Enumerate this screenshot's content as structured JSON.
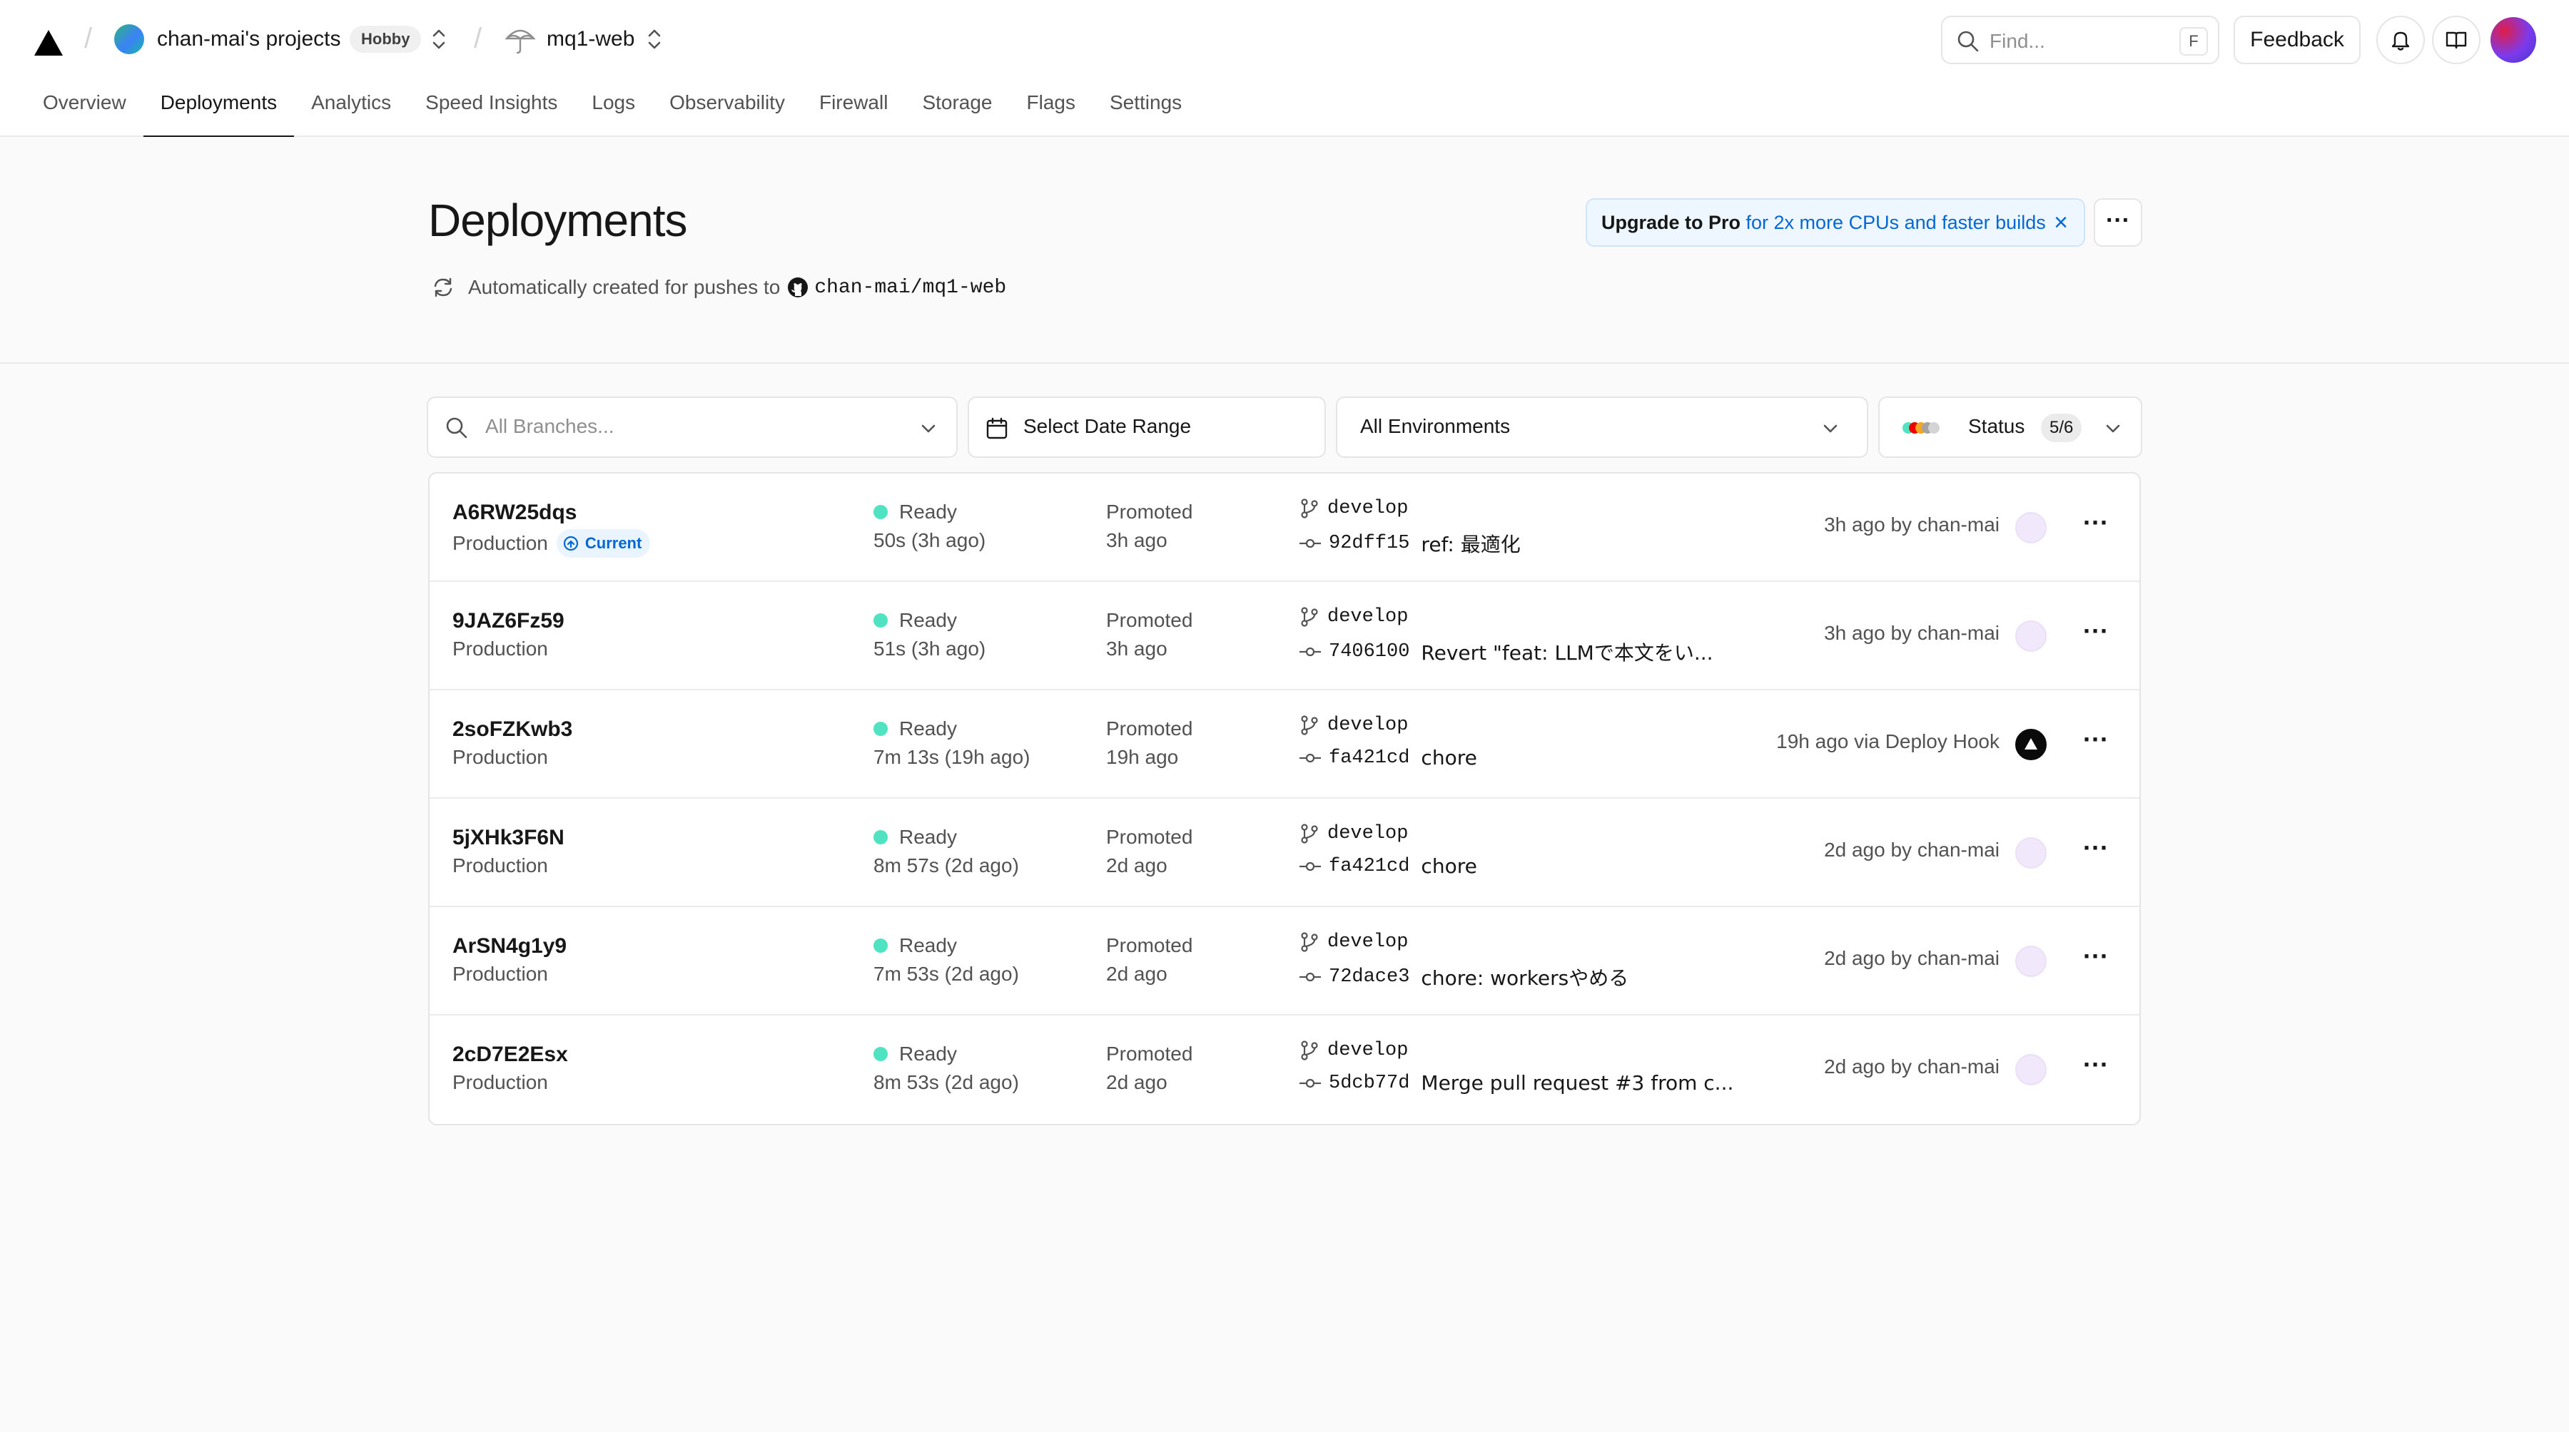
{
  "header": {
    "team_name": "chan-mai's projects",
    "plan_badge": "Hobby",
    "project_name": "mq1-web",
    "search": {
      "placeholder": "Find...",
      "shortcut": "F"
    },
    "feedback_label": "Feedback"
  },
  "tabs": [
    {
      "label": "Overview",
      "active": false
    },
    {
      "label": "Deployments",
      "active": true
    },
    {
      "label": "Analytics",
      "active": false
    },
    {
      "label": "Speed Insights",
      "active": false
    },
    {
      "label": "Logs",
      "active": false
    },
    {
      "label": "Observability",
      "active": false
    },
    {
      "label": "Firewall",
      "active": false
    },
    {
      "label": "Storage",
      "active": false
    },
    {
      "label": "Flags",
      "active": false
    },
    {
      "label": "Settings",
      "active": false
    }
  ],
  "page": {
    "title": "Deployments",
    "subtitle_prefix": "Automatically created for pushes to",
    "repo": "chan-mai/mq1-web",
    "upgrade_strong": "Upgrade to Pro",
    "upgrade_rest": "for 2x more CPUs and faster builds"
  },
  "filters": {
    "branches_placeholder": "All Branches...",
    "date_range": "Select Date Range",
    "environments": "All Environments",
    "status_label": "Status",
    "status_count": "5/6",
    "status_colors": [
      "#50e3c2",
      "#ee0000",
      "#f5a623",
      "#a3a3a3",
      "#d4d4d4"
    ]
  },
  "deployments": [
    {
      "id": "A6RW25dqs",
      "env": "Production",
      "current_label": "Current",
      "status": "Ready",
      "duration": "50s (3h ago)",
      "promoted": "Promoted",
      "promoted_ago": "3h ago",
      "branch": "develop",
      "sha": "92dff15",
      "message": "ref: 最適化",
      "meta": "3h ago by chan-mai"
    },
    {
      "id": "9JAZ6Fz59",
      "env": "Production",
      "status": "Ready",
      "duration": "51s (3h ago)",
      "promoted": "Promoted",
      "promoted_ago": "3h ago",
      "branch": "develop",
      "sha": "7406100",
      "message": "Revert \"feat: LLMで本文をい...",
      "meta": "3h ago by chan-mai"
    },
    {
      "id": "2soFZKwb3",
      "env": "Production",
      "status": "Ready",
      "duration": "7m 13s (19h ago)",
      "promoted": "Promoted",
      "promoted_ago": "19h ago",
      "branch": "develop",
      "sha": "fa421cd",
      "message": "chore",
      "meta": "19h ago via Deploy Hook"
    },
    {
      "id": "5jXHk3F6N",
      "env": "Production",
      "status": "Ready",
      "duration": "8m 57s (2d ago)",
      "promoted": "Promoted",
      "promoted_ago": "2d ago",
      "branch": "develop",
      "sha": "fa421cd",
      "message": "chore",
      "meta": "2d ago by chan-mai"
    },
    {
      "id": "ArSN4g1y9",
      "env": "Production",
      "status": "Ready",
      "duration": "7m 53s (2d ago)",
      "promoted": "Promoted",
      "promoted_ago": "2d ago",
      "branch": "develop",
      "sha": "72dace3",
      "message": "chore: workersやめる",
      "meta": "2d ago by chan-mai"
    },
    {
      "id": "2cD7E2Esx",
      "env": "Production",
      "status": "Ready",
      "duration": "8m 53s (2d ago)",
      "promoted": "Promoted",
      "promoted_ago": "2d ago",
      "branch": "develop",
      "sha": "5dcb77d",
      "message": "Merge pull request #3 from c...",
      "meta": "2d ago by chan-mai"
    }
  ],
  "colors": {
    "ready_dot": "#50e3c2",
    "accent_blue": "#0068d6"
  }
}
